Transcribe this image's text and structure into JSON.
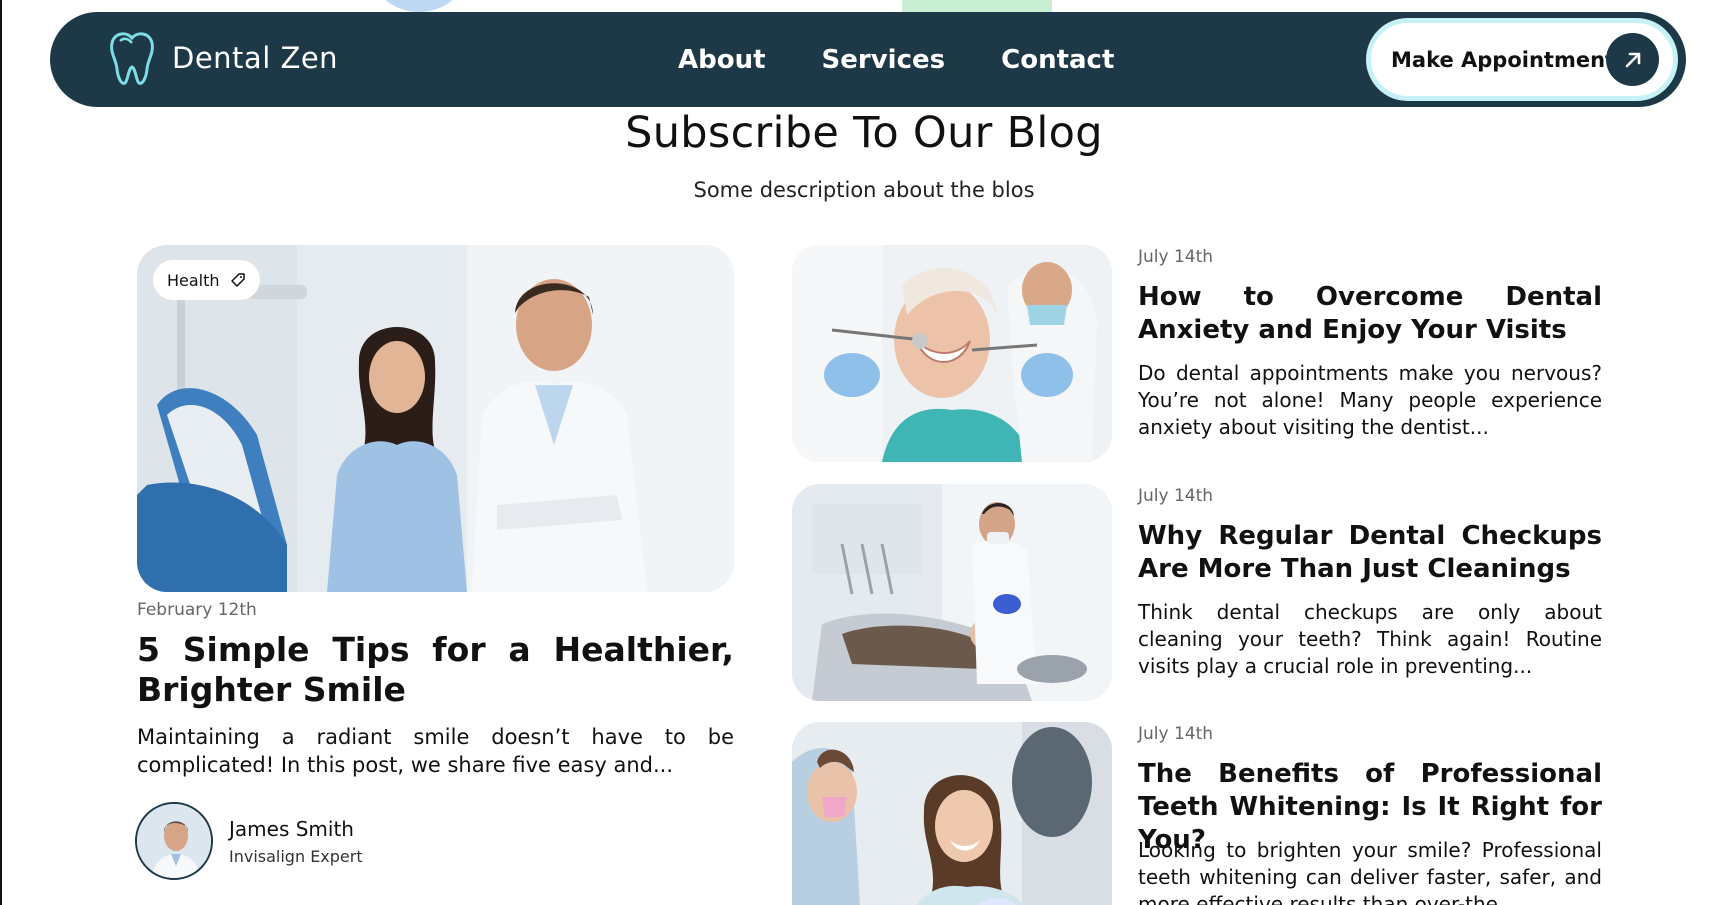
{
  "brand": {
    "name": "Dental Zen"
  },
  "nav": {
    "links": [
      "About",
      "Services",
      "Contact"
    ],
    "cta": "Make Appointment"
  },
  "header": {
    "title": "Subscribe To Our Blog",
    "description": "Some description about the blos"
  },
  "featured": {
    "tag": "Health",
    "date": "February 12th",
    "title": "5 Simple Tips for a Healthier, Brighter Smile",
    "excerpt": "Maintaining a radiant smile doesn’t have to be complicated! In this post, we share five easy and...",
    "author": {
      "name": "James Smith",
      "role": "Invisalign Expert"
    }
  },
  "posts": [
    {
      "date": "July 14th",
      "title": "How to Overcome Dental Anxiety and Enjoy Your Visits",
      "excerpt": "Do dental appointments make you nervous? You’re not alone! Many people experience anxiety about visiting the dentist..."
    },
    {
      "date": "July 14th",
      "title": "Why Regular Dental Checkups Are More Than Just Cleanings",
      "excerpt": "Think dental checkups are only about cleaning your teeth? Think again! Routine visits play a crucial role in preventing..."
    },
    {
      "date": "July 14th",
      "title": "The Benefits of Professional Teeth Whitening: Is It Right for You?",
      "excerpt": "Looking to brighten your smile? Professional teeth whitening can deliver faster, safer, and more effective results than over-the..."
    }
  ],
  "colors": {
    "navbar": "#1d3846",
    "accent": "#c6f1f7",
    "logo_stroke": "#7fdde8"
  }
}
